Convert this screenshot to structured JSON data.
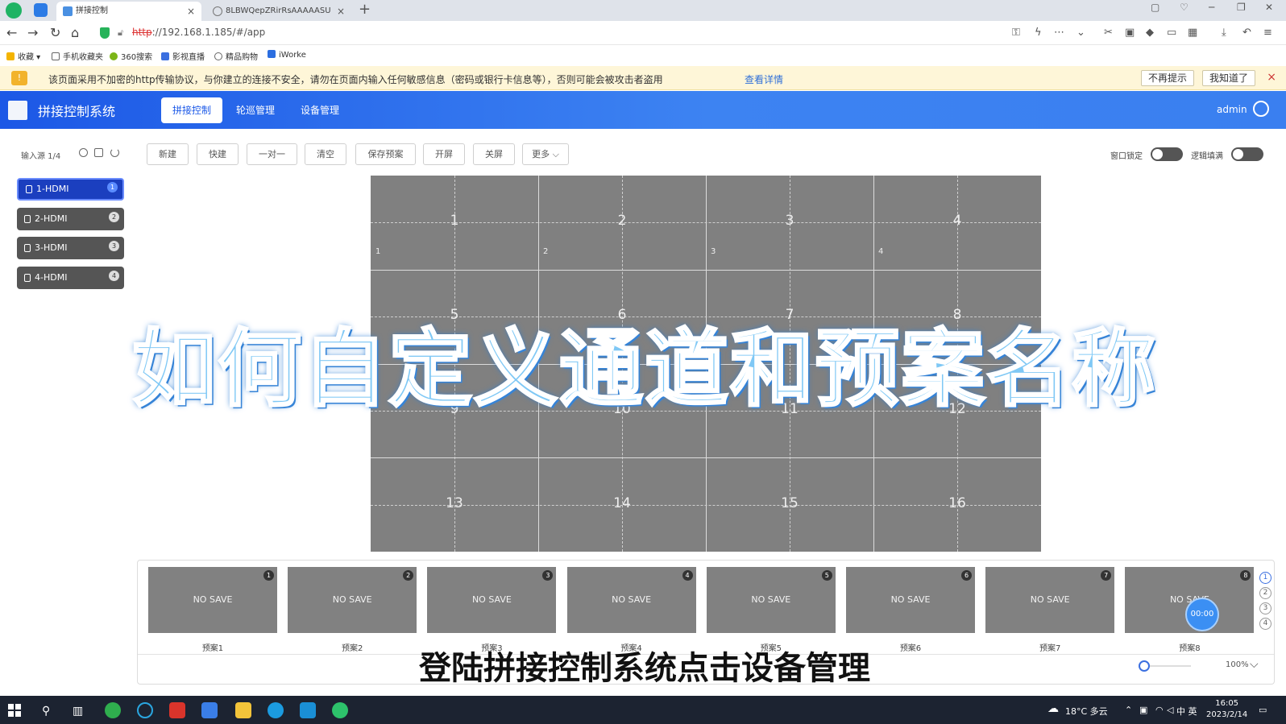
{
  "browser": {
    "tabs": [
      {
        "title": "拼接控制",
        "active": true
      },
      {
        "title": "8LBWQepZRirRsAAAAASU",
        "active": false
      }
    ],
    "new_tab": "+",
    "url": {
      "protocol": "http",
      "rest": "://192.168.1.185/#/app"
    },
    "bookmarks": [
      "收藏",
      "手机收藏夹",
      "360搜索",
      "影视直播",
      "精品购物",
      "iWorke"
    ],
    "warning": {
      "text": "该页面采用不加密的http传输协议，与你建立的连接不安全，请勿在页面内输入任何敏感信息（密码或银行卡信息等），否则可能会被攻击者盗用",
      "link": "查看详情",
      "btn_no_remind": "不再提示",
      "btn_know": "我知道了",
      "close": "×"
    }
  },
  "app": {
    "title": "拼接控制系统",
    "nav": [
      {
        "label": "拼接控制",
        "active": true
      },
      {
        "label": "轮巡管理",
        "active": false
      },
      {
        "label": "设备管理",
        "active": false
      }
    ],
    "user": "admin"
  },
  "sidebar": {
    "header": "输入源 1/4",
    "sources": [
      {
        "label": "1-HDMI",
        "badge": "1",
        "active": true
      },
      {
        "label": "2-HDMI",
        "badge": "2",
        "active": false
      },
      {
        "label": "3-HDMI",
        "badge": "3",
        "active": false
      },
      {
        "label": "4-HDMI",
        "badge": "4",
        "active": false
      }
    ]
  },
  "toolbar": {
    "buttons": [
      "新建",
      "快建",
      "一对一",
      "清空",
      "保存预案",
      "开屏",
      "关屏",
      "更多"
    ],
    "more_chevron": "⌵",
    "toggles": [
      {
        "label": "窗口锁定",
        "on": false
      },
      {
        "label": "逻辑填满",
        "on": false
      }
    ]
  },
  "wall": {
    "cells": [
      "1",
      "2",
      "3",
      "4",
      "5",
      "6",
      "7",
      "8",
      "9",
      "10",
      "11",
      "12",
      "13",
      "14",
      "15",
      "16"
    ],
    "window_numbers": [
      "1",
      "2",
      "3",
      "4"
    ]
  },
  "presets": {
    "items": [
      {
        "num": "1",
        "status": "NO SAVE",
        "label": "预案1"
      },
      {
        "num": "2",
        "status": "NO SAVE",
        "label": "预案2"
      },
      {
        "num": "3",
        "status": "NO SAVE",
        "label": "预案3"
      },
      {
        "num": "4",
        "status": "NO SAVE",
        "label": "预案4"
      },
      {
        "num": "5",
        "status": "NO SAVE",
        "label": "预案5"
      },
      {
        "num": "6",
        "status": "NO SAVE",
        "label": "预案6"
      },
      {
        "num": "7",
        "status": "NO SAVE",
        "label": "预案7"
      },
      {
        "num": "8",
        "status": "NO SAVE",
        "label": "预案8"
      }
    ],
    "pages": [
      "1",
      "2",
      "3",
      "4"
    ],
    "timer": "00:00",
    "zoom": "100%"
  },
  "overlay": {
    "title": "如何自定义通道和预案名称",
    "subtitle": "登陆拼接控制系统点击设备管理"
  },
  "taskbar": {
    "weather": "18°C 多云",
    "tray_text": "中 英",
    "time": "16:05",
    "date": "2023/2/14"
  }
}
